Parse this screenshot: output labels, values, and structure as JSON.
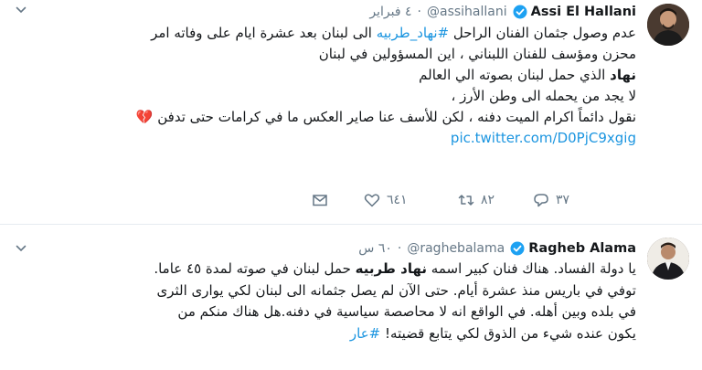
{
  "tweets": [
    {
      "name": "Assi El Hallani",
      "handle": "@assihallani",
      "time": "٤ فبراير",
      "dot": "·",
      "avatar_icon": "user-photo",
      "lines": {
        "l1a": "عدم وصول جثمان الفنان الراحل ",
        "l1b": "#نهاد_طربيه",
        "l1c": " الى لبنان بعد عشرة ايام على وفاته امر",
        "l2": "محزن ومؤسف للفنان اللبناني ، اين المسؤولين في لبنان",
        "l3a": "نهاد",
        "l3b": " الذي حمل لبنان بصوته الي العالم",
        "l4": "لا يجد من يحمله الى وطن الأرز ،",
        "l5a": "نقول دائماً اكرام الميت دفنه ، لكن للأسف عنا صاير العكس ما في كرامات حتى تدفن",
        "l5b": "💔",
        "l6": "pic.twitter.com/D0PjC9xgig"
      },
      "actions": {
        "reply_count": "٣٧",
        "retweet_count": "٨٢",
        "like_count": "٦٤١"
      }
    },
    {
      "name": "Ragheb Alama",
      "handle": "@raghebalama",
      "time": "٦٠ س",
      "dot": "·",
      "avatar_icon": "user-photo",
      "lines": {
        "l1a": "يا دولة الفساد. هناك فنان كبير اسمه ",
        "l1b": "نهاد طربيه",
        "l1c": " حمل لبنان في صوته لمدة ٤٥ عاما.",
        "l2": "توفي في باريس منذ عشرة أيام. حتى الآن لم يصل جثمانه الى لبنان لكي يوارى الثرى",
        "l3": "في بلده وبين أهله. في الواقع انه لا محاصصة سياسية في دفنه.هل هناك منكم من",
        "l4a": "يكون عنده شيء من الذوق لكي يتابع قضيته! ",
        "l4b": "#عار"
      }
    }
  ],
  "colors": {
    "link": "#1b95e0",
    "secondary": "#657786",
    "verified": "#1da1f2",
    "heart": "#cc3645"
  }
}
